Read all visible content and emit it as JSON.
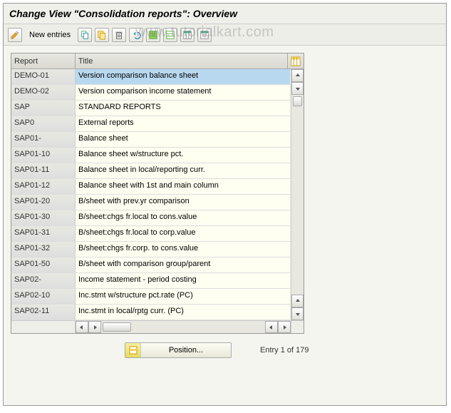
{
  "window": {
    "title": "Change View \"Consolidation reports\": Overview"
  },
  "toolbar": {
    "new_entries_label": "New entries"
  },
  "grid": {
    "columns": {
      "report": "Report",
      "title": "Title"
    },
    "rows": [
      {
        "report": "DEMO-01",
        "title": "Version comparison balance sheet",
        "selected": true
      },
      {
        "report": "DEMO-02",
        "title": "Version comparison income statement"
      },
      {
        "report": "SAP",
        "title": "STANDARD REPORTS"
      },
      {
        "report": "SAP0",
        "title": "External reports"
      },
      {
        "report": "SAP01-",
        "title": "Balance sheet"
      },
      {
        "report": "SAP01-10",
        "title": "Balance sheet w/structure pct."
      },
      {
        "report": "SAP01-11",
        "title": "Balance sheet in local/reporting curr."
      },
      {
        "report": "SAP01-12",
        "title": "Balance sheet with 1st and main column"
      },
      {
        "report": "SAP01-20",
        "title": "B/sheet with prev.yr comparison"
      },
      {
        "report": "SAP01-30",
        "title": "B/sheet:chgs fr.local to cons.value"
      },
      {
        "report": "SAP01-31",
        "title": "B/sheet:chgs fr.local to corp.value"
      },
      {
        "report": "SAP01-32",
        "title": "B/sheet:chgs fr.corp. to cons.value"
      },
      {
        "report": "SAP01-50",
        "title": "B/sheet with comparison group/parent"
      },
      {
        "report": "SAP02-",
        "title": "Income statement - period costing"
      },
      {
        "report": "SAP02-10",
        "title": "Inc.stmt w/structure pct.rate (PC)"
      },
      {
        "report": "SAP02-11",
        "title": "Inc.stmt in local/rptg curr. (PC)"
      }
    ]
  },
  "footer": {
    "position_label": "Position...",
    "status": "Entry 1 of 179"
  },
  "watermark": "www.tutorialkart.com"
}
